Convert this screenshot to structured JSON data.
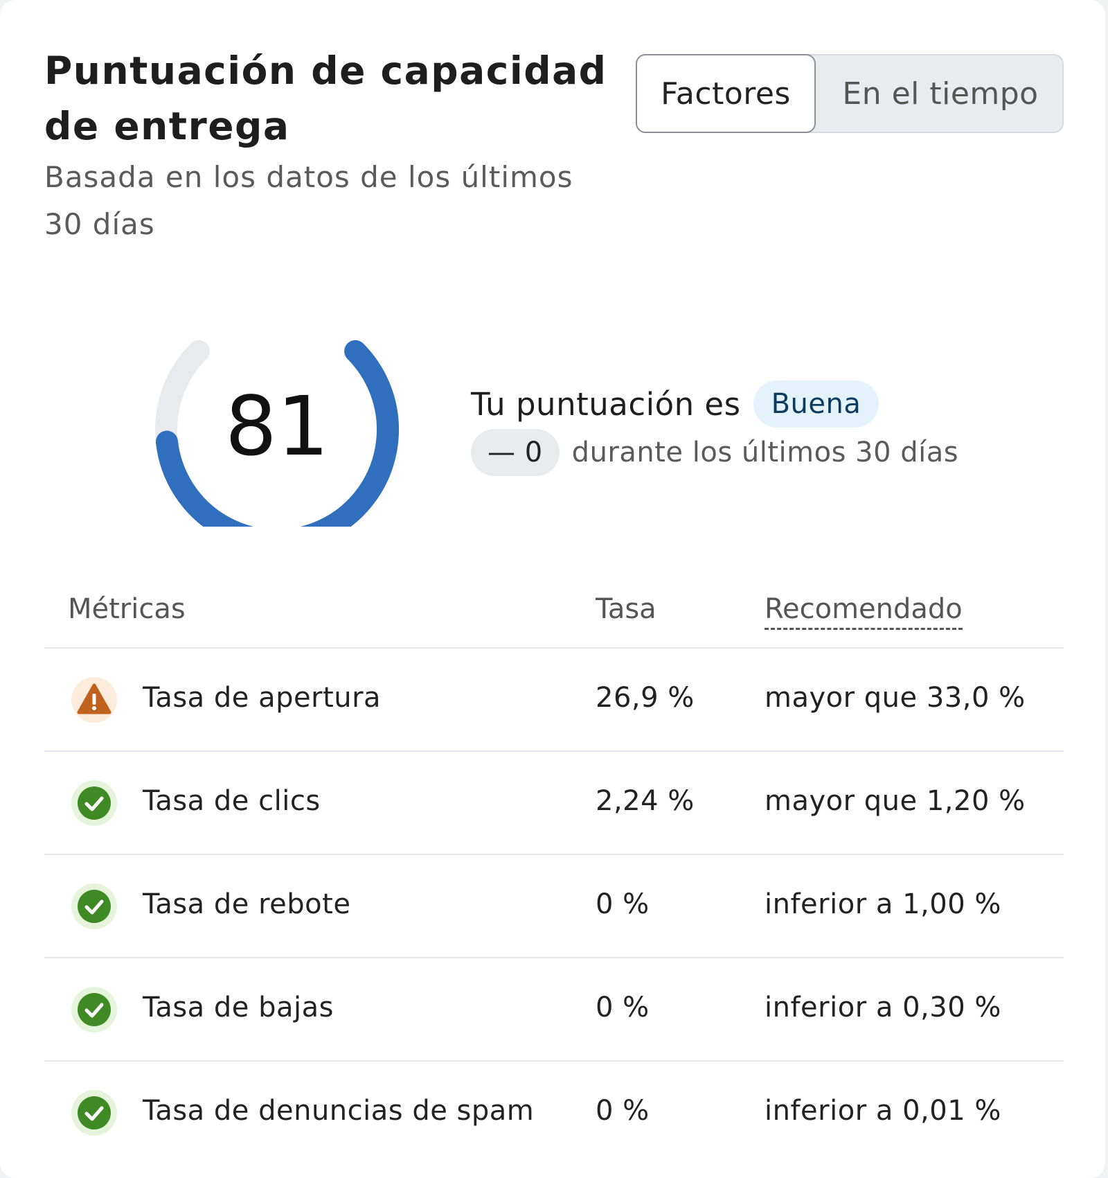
{
  "header": {
    "title": "Puntuación de capacidad de entrega",
    "subtitle": "Basada en los datos de los últimos 30 días"
  },
  "toggle": {
    "options": [
      "Factores",
      "En el tiempo"
    ],
    "selected": "Factores"
  },
  "score": {
    "value": "81",
    "max": 100,
    "label": "Tu puntuación es",
    "rating": "Buena",
    "trend_value": "— 0",
    "trend_text": "durante los últimos 30 días"
  },
  "colors": {
    "gauge_fill": "#2f6fbd",
    "gauge_track": "#e8eaed",
    "warning": "#c0621e",
    "success": "#3f8a24",
    "badge_bg": "#e4f3fb"
  },
  "table": {
    "headers": {
      "metric": "Métricas",
      "rate": "Tasa",
      "recommended": "Recomendado"
    },
    "rows": [
      {
        "status": "warning-icon",
        "metric": "Tasa de apertura",
        "rate": "26,9 %",
        "recommended": "mayor que 33,0 %"
      },
      {
        "status": "check-icon",
        "metric": "Tasa de clics",
        "rate": "2,24 %",
        "recommended": "mayor que 1,20 %"
      },
      {
        "status": "check-icon",
        "metric": "Tasa de rebote",
        "rate": "0 %",
        "recommended": "inferior a 1,00 %"
      },
      {
        "status": "check-icon",
        "metric": "Tasa de bajas",
        "rate": "0 %",
        "recommended": "inferior a 0,30 %"
      },
      {
        "status": "check-icon",
        "metric": "Tasa de denuncias de spam",
        "rate": "0 %",
        "recommended": "inferior a 0,01 %"
      }
    ]
  }
}
